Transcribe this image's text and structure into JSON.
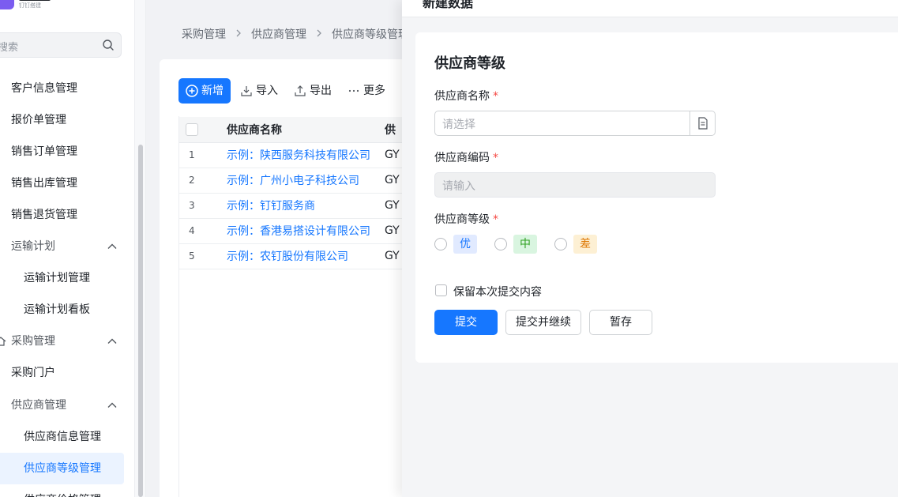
{
  "sidebar": {
    "search_placeholder": "搜索",
    "items": [
      {
        "label": "客户信息管理",
        "type": "item"
      },
      {
        "label": "报价单管理",
        "type": "item"
      },
      {
        "label": "销售订单管理",
        "type": "item"
      },
      {
        "label": "销售出库管理",
        "type": "item"
      },
      {
        "label": "销售退货管理",
        "type": "item"
      },
      {
        "label": "运输计划",
        "type": "group"
      },
      {
        "label": "运输计划管理",
        "type": "sub"
      },
      {
        "label": "运输计划看板",
        "type": "sub"
      },
      {
        "label": "采购管理",
        "type": "group"
      },
      {
        "label": "采购门户",
        "type": "item"
      },
      {
        "label": "供应商管理",
        "type": "group"
      },
      {
        "label": "供应商信息管理",
        "type": "sub"
      },
      {
        "label": "供应商等级管理",
        "type": "sub",
        "active": true
      },
      {
        "label": "供应商价格管理",
        "type": "sub"
      }
    ]
  },
  "breadcrumb": [
    "采购管理",
    "供应商管理",
    "供应商等级管理"
  ],
  "toolbar": {
    "new_label": "新增",
    "import_label": "导入",
    "export_label": "导出",
    "more_label": "更多"
  },
  "table": {
    "headers": [
      "",
      "供应商名称",
      "供"
    ],
    "rows": [
      {
        "idx": "1",
        "name": "示例：陕西服务科技有限公司",
        "code": "GY"
      },
      {
        "idx": "2",
        "name": "示例：广州小电子科技公司",
        "code": "GY"
      },
      {
        "idx": "3",
        "name": "示例：钉钉服务商",
        "code": "GY"
      },
      {
        "idx": "4",
        "name": "示例：香港易搭设计有限公司",
        "code": "GY"
      },
      {
        "idx": "5",
        "name": "示例：农钉股份有限公司",
        "code": "GY"
      }
    ]
  },
  "drawer": {
    "title": "新建数据",
    "form_title": "供应商等级",
    "field_supplier_name": "供应商名称",
    "field_supplier_name_placeholder": "请选择",
    "field_supplier_code": "供应商编码",
    "field_supplier_code_placeholder": "请输入",
    "field_supplier_level": "供应商等级",
    "levels": [
      "优",
      "中",
      "差"
    ],
    "required_mark": "*",
    "keep_label": "保留本次提交内容",
    "submit_label": "提交",
    "submit_continue_label": "提交并继续",
    "save_draft_label": "暂存"
  },
  "colors": {
    "primary": "#1677ff",
    "required": "#f54a45",
    "tag_good_bg": "#e1eaff",
    "tag_mid_bg": "#d9f5e0",
    "tag_bad_bg": "#fdf0d4"
  },
  "logo_subtitle": "钉钉搭建"
}
